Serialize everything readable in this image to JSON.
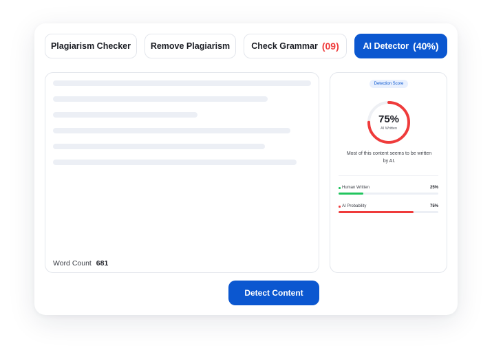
{
  "tabs": [
    {
      "label": "Plagiarism Checker",
      "count": ""
    },
    {
      "label": "Remove Plagiarism",
      "count": ""
    },
    {
      "label": "Check Grammar",
      "count": "(09)"
    },
    {
      "label": "AI Detector",
      "count": "(40%)",
      "active": true
    }
  ],
  "editor": {
    "word_count_label": "Word Count",
    "word_count_value": "681",
    "placeholder_line_count": 6
  },
  "detection": {
    "badge": "Detection Score",
    "score_text": "75%",
    "score_fraction": 0.75,
    "score_label": "AI Written",
    "verdict": "Most of this content seems to be written by AI.",
    "metrics": [
      {
        "name": "Human Written",
        "value": "25%",
        "fraction": 0.25,
        "color": "#22c55e"
      },
      {
        "name": "AI Probability",
        "value": "75%",
        "fraction": 0.75,
        "color": "#ef3b3b"
      }
    ]
  },
  "actions": {
    "detect_label": "Detect Content"
  },
  "colors": {
    "accent": "#0b57d0",
    "danger": "#ef3b3b",
    "success": "#22c55e"
  }
}
